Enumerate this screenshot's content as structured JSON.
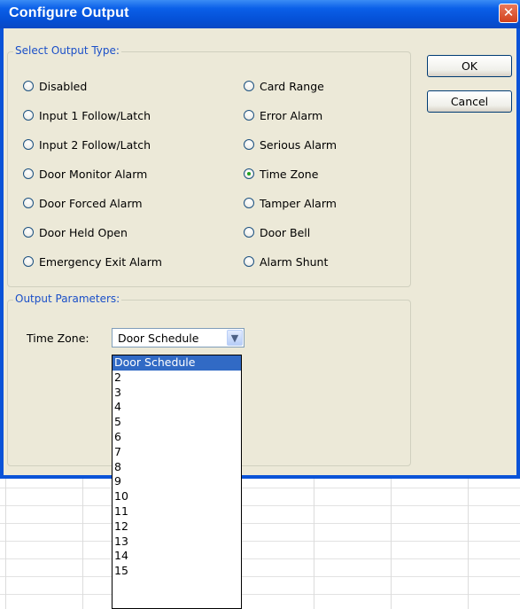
{
  "window": {
    "title": "Configure Output",
    "close_glyph": "✕"
  },
  "buttons": {
    "ok": "OK",
    "cancel": "Cancel"
  },
  "output_type": {
    "label": "Select Output Type:",
    "selected": "Time Zone",
    "left_options": [
      "Disabled",
      "Input 1 Follow/Latch",
      "Input 2 Follow/Latch",
      "Door Monitor Alarm",
      "Door Forced Alarm",
      "Door Held Open",
      "Emergency Exit Alarm"
    ],
    "right_options": [
      "Card Range",
      "Error Alarm",
      "Serious Alarm",
      "Time Zone",
      "Tamper Alarm",
      "Door Bell",
      "Alarm Shunt"
    ]
  },
  "output_parameters": {
    "label": "Output Parameters:",
    "time_zone_label": "Time Zone:",
    "time_zone_value": "Door Schedule",
    "dropdown_options": [
      "Door Schedule",
      "2",
      "3",
      "4",
      "5",
      "6",
      "7",
      "8",
      "9",
      "10",
      "11",
      "12",
      "13",
      "14",
      "15"
    ]
  },
  "colors": {
    "title_bar": "#0a5fe8",
    "dialog_face": "#ece9d8",
    "group_label": "#1a4fc8",
    "selection": "#316ac5",
    "radio_dot": "#21a121"
  }
}
